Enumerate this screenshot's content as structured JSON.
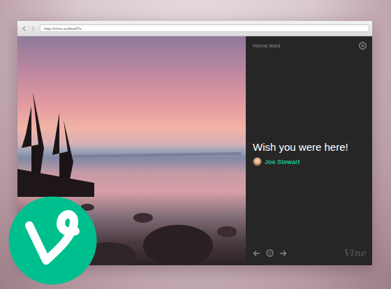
{
  "browser": {
    "url": "http://vine.co/feed?v"
  },
  "panel": {
    "title": "Home feed"
  },
  "post": {
    "caption": "Wish you were here!",
    "author": "Joe Stewart"
  },
  "brand": {
    "wordmark": "Vine"
  }
}
